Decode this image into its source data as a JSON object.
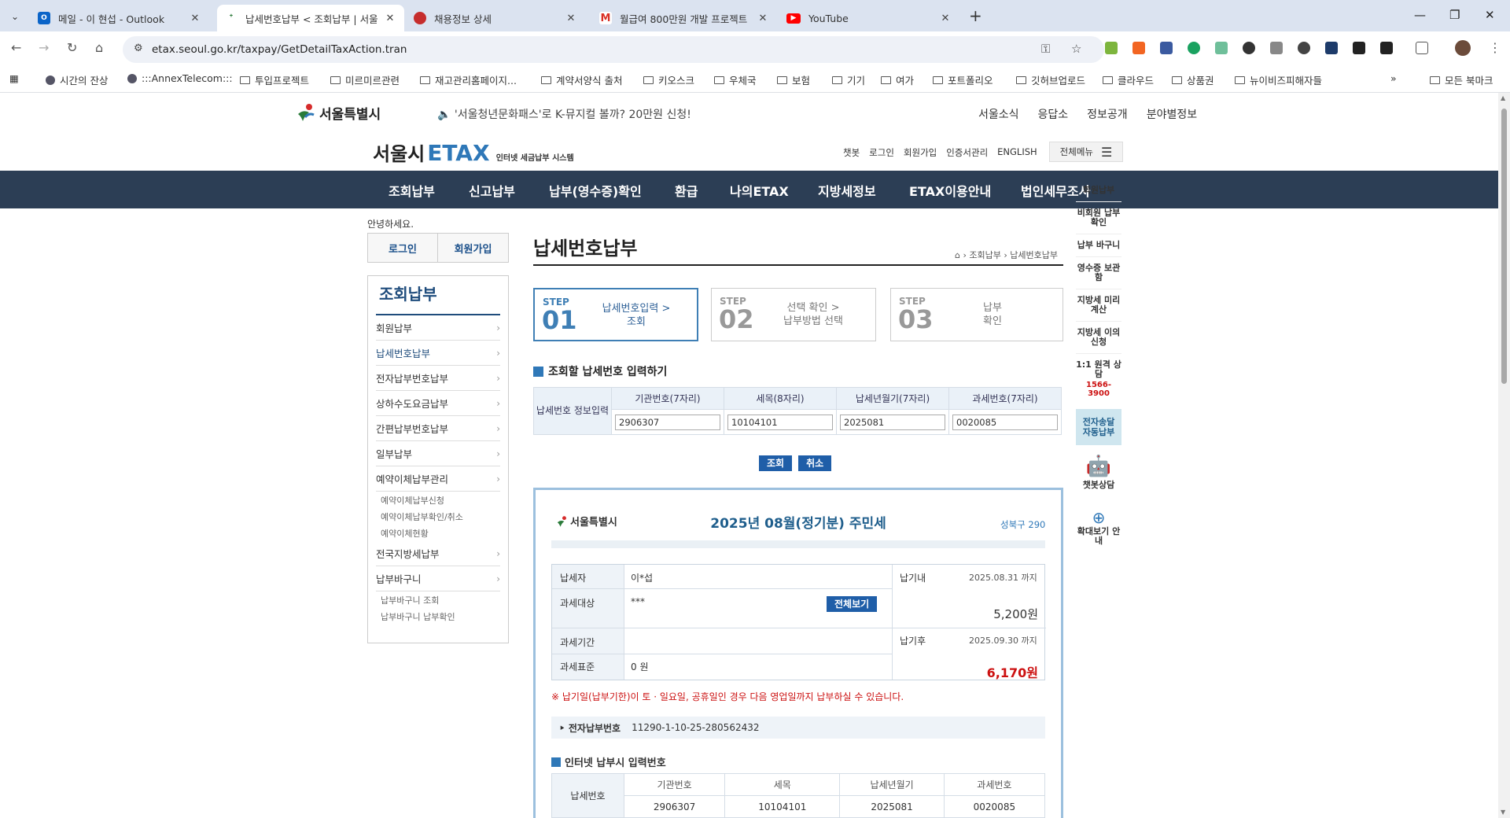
{
  "browser": {
    "tabs": [
      {
        "title": "메일 - 이 현섭 - Outlook",
        "icon": "outlook-icon"
      },
      {
        "title": "납세번호납부 < 조회납부 | 서울",
        "icon": "etax-icon"
      },
      {
        "title": "채용정보 상세",
        "icon": "globe-icon"
      },
      {
        "title": "월급여 800만원 개발 프로젝트",
        "icon": "gmail-icon"
      },
      {
        "title": "YouTube",
        "icon": "youtube-icon"
      }
    ],
    "url": "etax.seoul.go.kr/taxpay/GetDetailTaxAction.tran",
    "bookmarks": [
      "시간의 잔상",
      ":::AnnexTelecom:::",
      "투입프로젝트",
      "미르미르관련",
      "재고관리홈페이지...",
      "계약서양식 출처",
      "키오스크",
      "우체국",
      "보험",
      "기기",
      "여가",
      "포트폴리오",
      "깃허브업로드",
      "클라우드",
      "상품권",
      "뉴이비즈피해자들"
    ],
    "all_bookmarks": "모든 북마크"
  },
  "header": {
    "logo": "서울특별시",
    "notice": "'서울청년문화패스'로 K-뮤지컬 볼까? 20만원 신청!",
    "util": [
      "서울소식",
      "응답소",
      "정보공개",
      "분야별정보"
    ],
    "etax_title": "서울시",
    "etax_brand": "ETAX",
    "etax_sub": "인터넷 세금납부 시스템",
    "sub_util": [
      "챗봇",
      "로그인",
      "회원가입",
      "인증서관리",
      "ENGLISH"
    ],
    "all_menu": "전체메뉴"
  },
  "gnb": [
    "조회납부",
    "신고납부",
    "납부(영수증)확인",
    "환급",
    "나의ETAX",
    "지방세정보",
    "ETAX이용안내",
    "법인세무조사"
  ],
  "side": {
    "greet": "안녕하세요.",
    "login": "로그인",
    "join": "회원가입",
    "lnb_title": "조회납부",
    "items": [
      "회원납부",
      "납세번호납부",
      "전자납부번호납부",
      "상하수도요금납부",
      "간편납부번호납부",
      "일부납부",
      "예약이체납부관리"
    ],
    "sub1": [
      "예약이체납부신청",
      "예약이체납부확인/취소",
      "예약이체현황"
    ],
    "items2": [
      "전국지방세납부",
      "납부바구니"
    ],
    "sub2": [
      "납부바구니 조회",
      "납부바구니 납부확인"
    ]
  },
  "main": {
    "title": "납세번호납부",
    "breadcrumb": "조회납부",
    "breadcrumb_current": "납세번호납부",
    "steps": [
      {
        "label": "STEP",
        "num": "01",
        "desc1": "납세번호입력 >",
        "desc2": "조회"
      },
      {
        "label": "STEP",
        "num": "02",
        "desc1": "선택 확인 >",
        "desc2": "납부방법 선택"
      },
      {
        "label": "STEP",
        "num": "03",
        "desc1": "납부",
        "desc2": "확인"
      }
    ],
    "input_heading": "조회할 납세번호 입력하기",
    "input_row_label": "납세번호 정보입력",
    "cols": [
      "기관번호(7자리)",
      "세목(8자리)",
      "납세년월기(7자리)",
      "과세번호(7자리)"
    ],
    "values": [
      "2906307",
      "10104101",
      "2025081",
      "0020085"
    ],
    "btn_search": "조회",
    "btn_cancel": "취소"
  },
  "bill": {
    "logo": "서울특별시",
    "title": "2025년 08월(정기분) 주민세",
    "office": "성북구 290",
    "taxpayer_label": "납세자",
    "taxpayer": "이*섭",
    "object_label": "과세대상",
    "object": "***",
    "view_all": "전체보기",
    "period_label": "과세기간",
    "period": "",
    "standard_label": "과세표준",
    "standard": "0 원",
    "due_label": "납기내",
    "due_date": "2025.08.31 까지",
    "due_amount": "5,200원",
    "after_label": "납기후",
    "after_date": "2025.09.30 까지",
    "after_amount": "6,170원",
    "warning": "※ 납기일(납부기한)이 토 · 일요일, 공휴일인 경우 다음 영업일까지 납부하실 수 있습니다.",
    "epay_label": "전자납부번호",
    "epay_no": "11290-1-10-25-280562432",
    "inet_heading": "인터넷 납부시 입력번호",
    "inet_row_label": "납세번호",
    "inet_cols": [
      "기관번호",
      "세목",
      "납세년월기",
      "과세번호"
    ],
    "inet_vals": [
      "2906307",
      "10104101",
      "2025081",
      "0020085"
    ]
  },
  "rail": [
    "회원납부",
    "비회원 납부확인",
    "납부 바구니",
    "영수증 보관함",
    "지방세 미리계산",
    "지방세 이의신청",
    "1:1 원격 상담",
    "1566-3900",
    "전자송달 자동납부",
    "챗봇상담",
    "확대보기 안내"
  ],
  "colors": {
    "gnb": "#2c3e55",
    "brand": "#2f78b8",
    "red": "#cc1111",
    "accent": "#1f5ea8"
  }
}
